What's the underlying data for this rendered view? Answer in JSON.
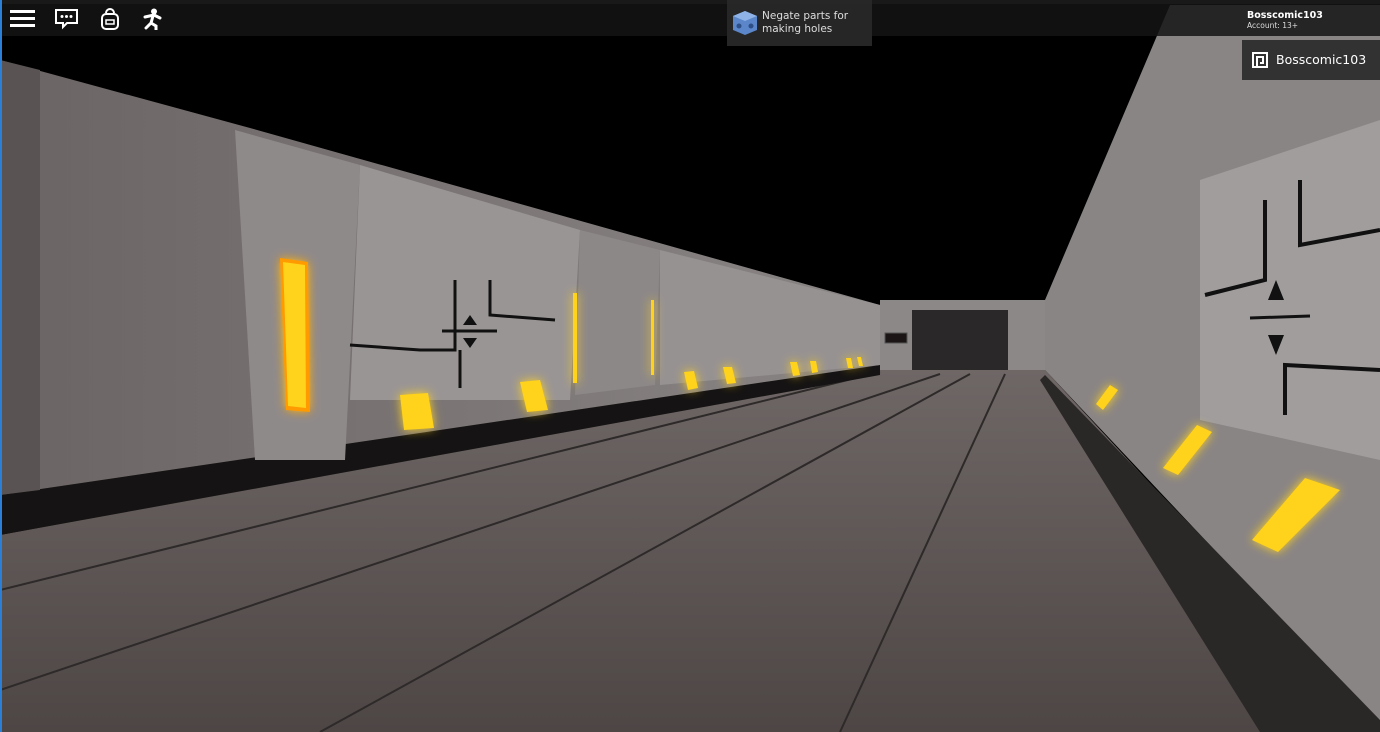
{
  "tooltip": {
    "text": "Negate parts for making holes",
    "icon": "negate-cube-icon"
  },
  "account": {
    "username": "Bosscomic103",
    "account_label": "Account: 13+"
  },
  "playerlist": {
    "players": [
      {
        "name": "Bosscomic103",
        "icon": "premium-icon"
      }
    ]
  },
  "topbar": {
    "icons": [
      "menu-icon",
      "chat-icon",
      "backpack-icon",
      "emote-icon"
    ]
  },
  "colors": {
    "accent_glow": "#ffb000",
    "wall": "#7a7474",
    "floor": "#5e5756"
  }
}
